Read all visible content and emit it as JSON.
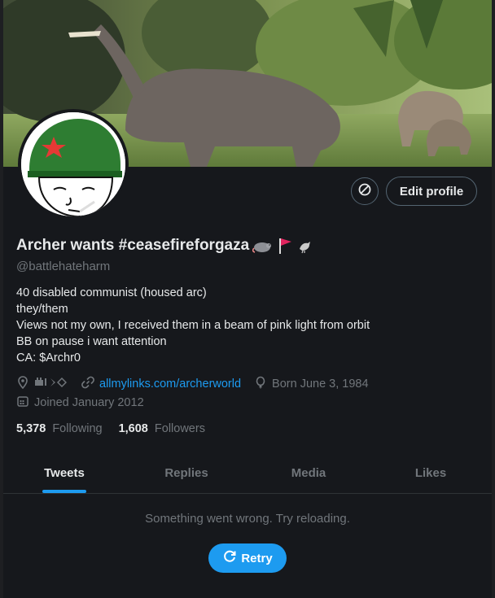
{
  "profile": {
    "display_name": "Archer wants #ceasefireforgaza",
    "emoji": [
      "rat-emoji",
      "red-flag-emoji",
      "bird-emoji"
    ],
    "handle": "@battlehateharm",
    "bio": [
      "40 disabled communist (housed arc)",
      "they/them",
      "Views not my own, I received them in a beam of pink light from orbit",
      "BB on pause i want attention",
      "CA: $Archr0"
    ],
    "link": "allmylinks.com/archerworld",
    "birthday": "Born June 3, 1984",
    "joined": "Joined January 2012",
    "following_count": "5,378",
    "following_label": "Following",
    "followers_count": "1,608",
    "followers_label": "Followers"
  },
  "actions": {
    "edit_profile": "Edit profile",
    "retry": "Retry"
  },
  "tabs": [
    "Tweets",
    "Replies",
    "Media",
    "Likes"
  ],
  "active_tab": "Tweets",
  "feed": {
    "error_message": "Something went wrong. Try reloading."
  },
  "colors": {
    "accent": "#1d9bf0",
    "background": "#16181c",
    "muted_text": "#71767b"
  }
}
